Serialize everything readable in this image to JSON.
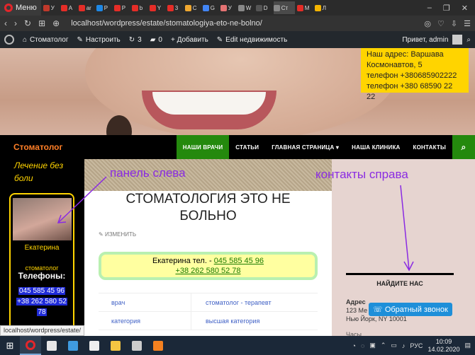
{
  "browser": {
    "menu_label": "Меню",
    "tabs": [
      {
        "label": "У",
        "color": "#c0392b"
      },
      {
        "label": "А",
        "color": "#e52d27"
      },
      {
        "label": "ar",
        "color": "#e52d27"
      },
      {
        "label": "Р",
        "color": "#1e88e5"
      },
      {
        "label": "Р",
        "color": "#e52d27"
      },
      {
        "label": "b",
        "color": "#e52d27"
      },
      {
        "label": "Y",
        "color": "#e52d27"
      },
      {
        "label": "3",
        "color": "#e52d27"
      },
      {
        "label": "С",
        "color": "#f0a830"
      },
      {
        "label": "G",
        "color": "#4285f4"
      },
      {
        "label": "У",
        "color": "#e57373"
      },
      {
        "label": "W",
        "color": "#888888"
      },
      {
        "label": "D",
        "color": "#555555"
      },
      {
        "label": "Ст",
        "color": "#888888"
      },
      {
        "label": "M",
        "color": "#e52d27"
      },
      {
        "label": "Л",
        "color": "#f4b400"
      }
    ],
    "url": "localhost/wordpress/estate/stomatologiya-eto-ne-bolno/"
  },
  "wp_admin": {
    "site": "Стоматолог",
    "customize": "Настроить",
    "updates": "3",
    "comments": "0",
    "add_new": "+ Добавить",
    "edit": "Edit недвижимость",
    "greeting": "Привет, admin"
  },
  "hero": {
    "contact_lines": [
      "Наш адрес: Варшава",
      "Космонавтов, 5",
      "телефон +380685902222",
      "телефон +380 68590 22 22"
    ]
  },
  "site_nav": {
    "title": "Стоматолог",
    "items": [
      "НАШИ ВРАЧИ",
      "СТАТЬИ",
      "ГЛАВНАЯ СТРАНИЦА ▾",
      "НАША КЛИНИКА",
      "КОНТАКТЫ"
    ],
    "active_index": 0
  },
  "left_panel": {
    "tagline": "Лечение без боли",
    "doctor_name": "Екатерина",
    "doctor_role": "стоматолог",
    "phones_heading": "Телефоны:",
    "phones": [
      "045 585 45 96",
      "+38 262 580 52",
      "78"
    ]
  },
  "post": {
    "title": "СТОМАТОЛОГИЯ ЭТО НЕ БОЛЬНО",
    "edit_label": "ИЗМЕНИТЬ",
    "phone_prefix": "Екатерина тел. - ",
    "phone1": "045 585 45 96",
    "phone2": "+38 262 580 52 78",
    "table": [
      [
        "врач",
        "стоматолог - терапевт"
      ],
      [
        "категория",
        "высшая категория"
      ]
    ]
  },
  "right_sidebar": {
    "heading": "НАЙДИТЕ НАС",
    "address_label": "Адрес",
    "address_line1": "123 Ме",
    "address_line2": "Нью Йорк, NY 10001",
    "hours_label": "Часы",
    "callback_button": "Обратный звонок"
  },
  "annotations": {
    "left": "панель слева",
    "right": "контакты справа",
    "color": "#8a2be2"
  },
  "status_url": "localhost/wordpress/estate/",
  "taskbar": {
    "lang": "РУС",
    "time": "10:09",
    "date": "14.02.2020"
  }
}
